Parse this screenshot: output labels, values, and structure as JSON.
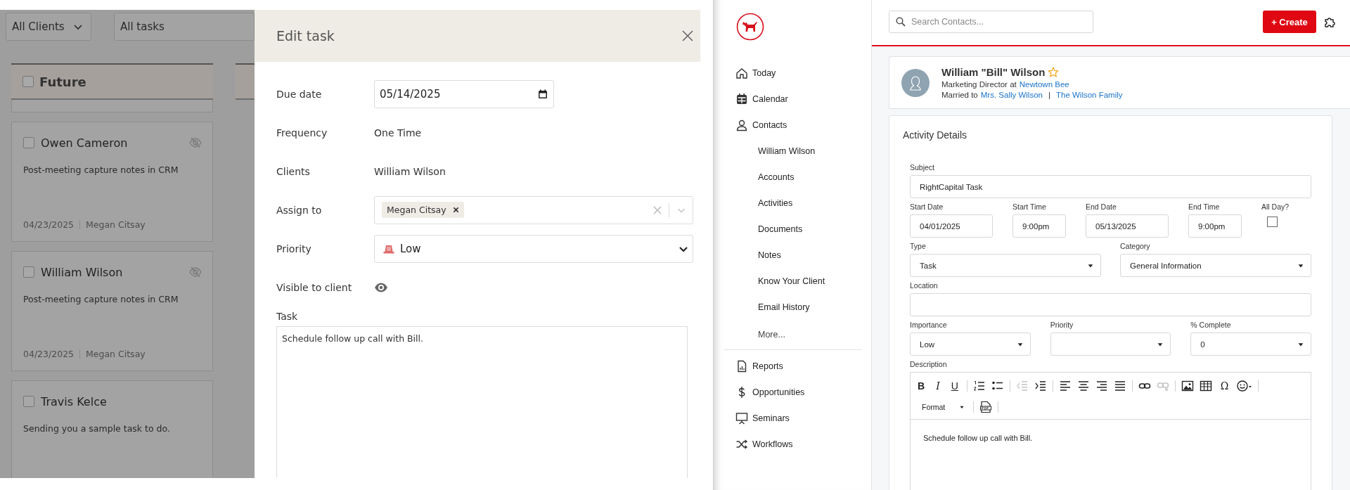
{
  "task_board": {
    "filters": [
      {
        "label": "All Clients",
        "kind": "dropdown"
      },
      {
        "label": "All tasks",
        "kind": "plain"
      }
    ],
    "columns": [
      {
        "title": "Future",
        "checked": false
      }
    ],
    "cards": [
      {
        "client": "Owen Cameron",
        "checked": false,
        "visible_to_client": false,
        "task": "Post-meeting capture notes in CRM",
        "due": "04/23/2025",
        "assignee": "Megan Citsay"
      },
      {
        "client": "William Wilson",
        "checked": false,
        "visible_to_client": false,
        "task": "Post-meeting capture notes in CRM",
        "due": "04/23/2025",
        "assignee": "Megan Citsay"
      },
      {
        "client": "Travis Kelce",
        "checked": false,
        "visible_to_client": true,
        "task": "Sending you a sample task to do."
      }
    ]
  },
  "edit_task": {
    "title": "Edit task",
    "fields": [
      {
        "label": "Due date",
        "kind": "date",
        "value": "05/14/2025"
      },
      {
        "label": "Frequency",
        "kind": "text",
        "value": "One Time"
      },
      {
        "label": "Clients",
        "kind": "text",
        "value": "William Wilson"
      },
      {
        "label": "Assign to",
        "kind": "tags",
        "tags": [
          "Megan Citsay"
        ]
      },
      {
        "label": "Priority",
        "kind": "select",
        "value": "Low"
      },
      {
        "label": "Visible to client",
        "kind": "visibility",
        "visible": true
      }
    ],
    "task": {
      "label": "Task",
      "value": "Schedule follow up call with Bill."
    }
  },
  "crm": {
    "search": {
      "placeholder": "Search Contacts..."
    },
    "create_button": "+ Create",
    "nav": [
      {
        "label": "Today"
      },
      {
        "label": "Calendar"
      },
      {
        "label": "Contacts",
        "children": [
          {
            "label": "William Wilson"
          },
          {
            "label": "Accounts"
          },
          {
            "label": "Activities"
          },
          {
            "label": "Documents"
          },
          {
            "label": "Notes"
          },
          {
            "label": "Know Your Client"
          },
          {
            "label": "Email History"
          },
          {
            "label": "More...",
            "kind": "more"
          }
        ]
      },
      {
        "label": "Reports"
      },
      {
        "label": "Opportunities"
      },
      {
        "label": "Seminars"
      },
      {
        "label": "Workflows"
      }
    ],
    "contact": {
      "name": "William \"Bill\" Wilson",
      "favorite": false,
      "title_line": "Marketing Director at",
      "company": "Newtown Bee",
      "relation_line": "Married to",
      "spouse": "Mrs. Sally Wilson",
      "separator": "|",
      "household": "The Wilson Family"
    },
    "activity": {
      "title": "Activity Details",
      "groups": [
        {
          "fields": [
            {
              "label": "Subject",
              "kind": "input",
              "value": "RightCapital Task"
            }
          ]
        },
        {
          "fields": [
            {
              "label": "Start Date",
              "kind": "input",
              "value": "04/01/2025"
            },
            {
              "label": "Start Time",
              "kind": "input",
              "value": "9:00pm"
            },
            {
              "label": "End Date",
              "kind": "input",
              "value": "05/13/2025"
            },
            {
              "label": "End Time",
              "kind": "input",
              "value": "9:00pm"
            },
            {
              "label": "All Day?",
              "kind": "checkbox",
              "checked": false
            }
          ]
        },
        {
          "fields": [
            {
              "label": "Type",
              "kind": "select",
              "value": "Task"
            },
            {
              "label": "Category",
              "kind": "select",
              "value": "General Information"
            }
          ]
        },
        {
          "fields": [
            {
              "label": "Location",
              "kind": "input"
            }
          ]
        },
        {
          "fields": [
            {
              "label": "Importance",
              "kind": "select",
              "value": "Low"
            },
            {
              "label": "Priority",
              "kind": "select"
            },
            {
              "label": "% Complete",
              "kind": "select",
              "value": "0"
            }
          ]
        }
      ],
      "description": {
        "label": "Description",
        "toolbar": [
          [
            {
              "kind": "text",
              "label": "B"
            },
            {
              "kind": "text",
              "label": "I"
            },
            {
              "kind": "text",
              "label": "U"
            },
            {
              "kind": "divider"
            },
            {
              "kind": "icon",
              "disabled": false
            },
            {
              "kind": "icon",
              "disabled": false
            },
            {
              "kind": "divider"
            },
            {
              "kind": "icon",
              "disabled": true
            },
            {
              "kind": "icon",
              "disabled": false
            },
            {
              "kind": "divider"
            },
            {
              "kind": "icon",
              "disabled": false
            },
            {
              "kind": "icon",
              "disabled": false
            },
            {
              "kind": "icon",
              "disabled": false
            },
            {
              "kind": "icon",
              "disabled": false
            },
            {
              "kind": "divider"
            },
            {
              "kind": "icon",
              "disabled": false
            },
            {
              "kind": "icon",
              "disabled": true
            },
            {
              "kind": "divider"
            },
            {
              "kind": "icon",
              "disabled": false
            },
            {
              "kind": "icon",
              "disabled": false
            },
            {
              "kind": "text",
              "label": "Ω"
            },
            {
              "kind": "icon",
              "disabled": false
            },
            {
              "kind": "divider"
            }
          ],
          [
            {
              "kind": "dropdown",
              "label": "Format"
            },
            {
              "kind": "divider"
            },
            {
              "kind": "icon",
              "disabled": false
            },
            {
              "kind": "divider"
            }
          ]
        ],
        "content": "Schedule follow up call with Bill."
      }
    }
  }
}
